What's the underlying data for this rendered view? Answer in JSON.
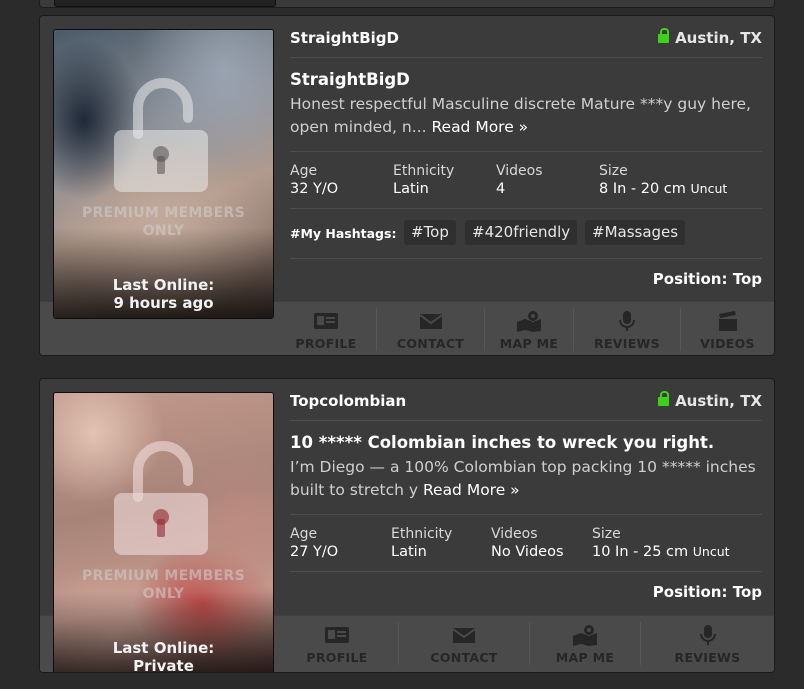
{
  "colors": {
    "page_bg": "#2b2b2b",
    "card_bg": "#3b3b3b",
    "action_bar": "#4a4a4a",
    "online_lock": "#3fd21b"
  },
  "profiles": [
    {
      "username": "StraightBigD",
      "location": "Austin, TX",
      "headline": "StraightBigD",
      "description": "Honest respectful Masculine discrete Mature ***y guy here, open minded, n...",
      "read_more": "Read More »",
      "premium_text": "PREMIUM MEMBERS\nONLY",
      "last_online_label": "Last Online:",
      "last_online_value": "9 hours ago",
      "stats": {
        "age_label": "Age",
        "age": "32 Y/O",
        "ethnicity_label": "Ethnicity",
        "ethnicity": "Latin",
        "videos_label": "Videos",
        "videos": "4",
        "size_label": "Size",
        "size": "8 In - 20 cm",
        "size_unit": "Uncut"
      },
      "hashtags_label": "#My Hashtags:",
      "hashtags": [
        "#Top",
        "#420friendly",
        "#Massages"
      ],
      "position_label": "Position:",
      "position": "Top",
      "actions": [
        {
          "label": "PROFILE",
          "icon": "profile-card-icon"
        },
        {
          "label": "CONTACT",
          "icon": "envelope-icon"
        },
        {
          "label": "MAP ME",
          "icon": "map-pin-icon"
        },
        {
          "label": "REVIEWS",
          "icon": "microphone-icon"
        },
        {
          "label": "VIDEOS",
          "icon": "clapperboard-icon"
        }
      ]
    },
    {
      "username": "Topcolombian",
      "location": "Austin, TX",
      "headline": "10 ***** Colombian inches to wreck you right.",
      "description": "I’m Diego — a 100% Colombian top packing 10 ***** inches built to stretch y",
      "read_more": "Read More »",
      "premium_text": "PREMIUM MEMBERS\nONLY",
      "last_online_label": "Last Online:",
      "last_online_value": "Private",
      "stats": {
        "age_label": "Age",
        "age": "27 Y/O",
        "ethnicity_label": "Ethnicity",
        "ethnicity": "Latin",
        "videos_label": "Videos",
        "videos": "No Videos",
        "size_label": "Size",
        "size": "10 In - 25 cm",
        "size_unit": "Uncut"
      },
      "position_label": "Position:",
      "position": "Top",
      "actions": [
        {
          "label": "PROFILE",
          "icon": "profile-card-icon"
        },
        {
          "label": "CONTACT",
          "icon": "envelope-icon"
        },
        {
          "label": "MAP ME",
          "icon": "map-pin-icon"
        },
        {
          "label": "REVIEWS",
          "icon": "microphone-icon"
        }
      ]
    }
  ]
}
